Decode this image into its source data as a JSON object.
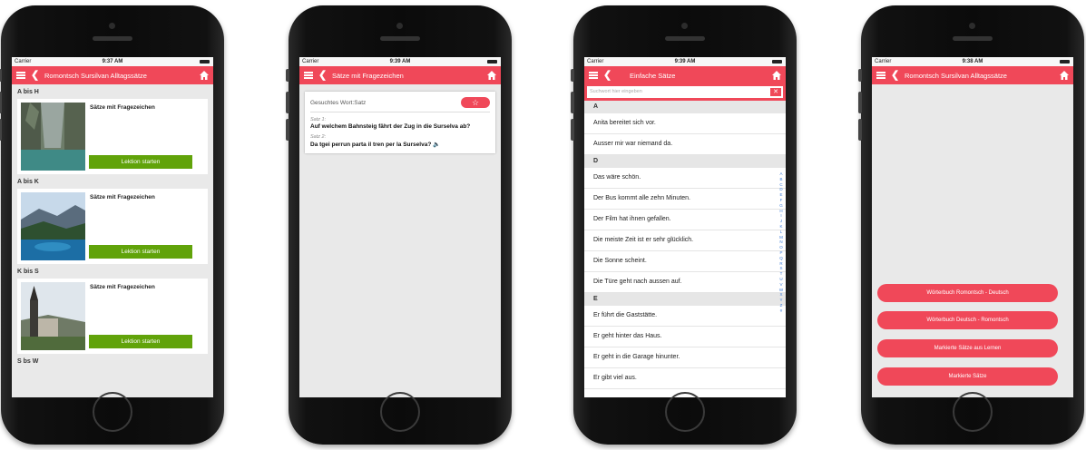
{
  "phones": [
    {
      "status": {
        "carrier": "Carrier",
        "time": "9:37 AM"
      },
      "title": "Romontsch Sursilvan Alltagssätze",
      "sections": [
        {
          "header": "A bis H",
          "card_title": "Sätze mit Fragezeichen",
          "button": "Lektion starten"
        },
        {
          "header": "A bis K",
          "card_title": "Sätze mit Fragezeichen",
          "button": "Lektion starten"
        },
        {
          "header": "K bis S",
          "card_title": "Sätze mit Fragezeichen",
          "button": "Lektion starten"
        }
      ],
      "last_header": "S bs W"
    },
    {
      "status": {
        "carrier": "Carrier",
        "time": "9:39 AM"
      },
      "title": "Sätze mit Fragezeichen",
      "search_label": "Gesuchtes Wort:Satz",
      "sentence1_label": "Satz 1:",
      "sentence1": "Auf welchem Bahnsteig fährt der Zug in die Surselva ab?",
      "sentence2_label": "Satz 2:",
      "sentence2": "Da tgei perrun parta il tren per la Surselva? 🔈"
    },
    {
      "status": {
        "carrier": "Carrier",
        "time": "9:39 AM"
      },
      "title": "Einfache Sätze",
      "search_placeholder": "Suchwort hier eingeben",
      "list": [
        {
          "header": "A",
          "items": [
            "Anita bereitet sich vor.",
            "Ausser mir war niemand da."
          ]
        },
        {
          "header": "D",
          "items": [
            "Das wäre schön.",
            "Der Bus kommt alle zehn Minuten.",
            "Der Film hat ihnen gefallen.",
            "Die meiste Zeit ist er sehr glücklich.",
            "Die Sonne scheint.",
            "Die Türe geht nach aussen auf."
          ]
        },
        {
          "header": "E",
          "items": [
            "Er führt die Gaststätte.",
            "Er geht hinter das Haus.",
            "Er geht in die Garage hinunter.",
            "Er gibt viel aus."
          ]
        }
      ],
      "alphabet": [
        "A",
        "B",
        "C",
        "D",
        "E",
        "F",
        "G",
        "H",
        "I",
        "J",
        "K",
        "L",
        "M",
        "N",
        "O",
        "P",
        "Q",
        "R",
        "S",
        "T",
        "U",
        "V",
        "W",
        "X",
        "Y",
        "Z",
        "#"
      ]
    },
    {
      "status": {
        "carrier": "Carrier",
        "time": "9:38 AM"
      },
      "title": "Romontsch Sursilvan Alltagssätze",
      "buttons": [
        "Wörterbuch Romontsch - Deutsch",
        "Wörterbuch Deutsch - Romontsch",
        "Markierte Sätze aus Lernen",
        "Markierte Sätze"
      ]
    }
  ],
  "colors": {
    "accent": "#f04859",
    "lesson_button": "#61a30a"
  }
}
